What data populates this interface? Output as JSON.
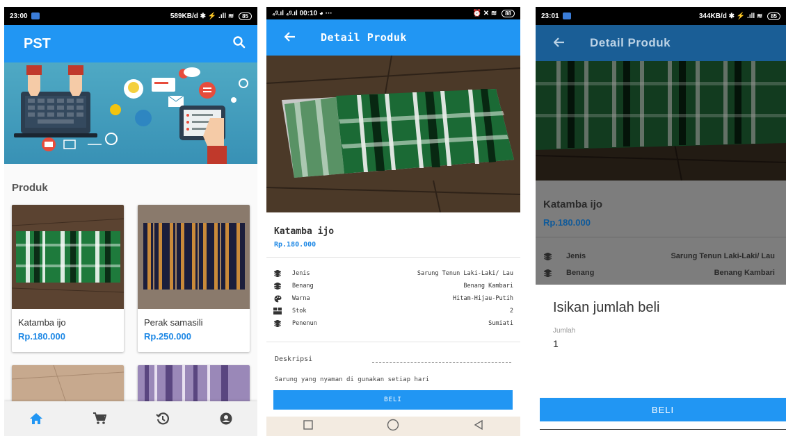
{
  "screen_home": {
    "status": {
      "time": "23:00",
      "right": "589KB/d ✱ ⚡ .ıll ≋",
      "battery": "85"
    },
    "app_title": "PST",
    "section_title": "Produk",
    "products": [
      {
        "name": "Katamba ijo",
        "price": "Rp.180.000"
      },
      {
        "name": "Perak samasili",
        "price": "Rp.250.000"
      }
    ]
  },
  "screen_detail": {
    "status": {
      "left": "₄ᵍ.ıl ₄ᵍ.ıl 00:10 ◕ ···",
      "right": "⏰ ✕ ≋",
      "battery": "88"
    },
    "title": "Detail Produk",
    "product_name": "Katamba ijo",
    "price": "Rp.180.000",
    "specs": [
      {
        "key": "Jenis",
        "value": "Sarung Tenun Laki-Laki/ Lau",
        "icon": "layers-icon"
      },
      {
        "key": "Benang",
        "value": "Benang Kambari",
        "icon": "layers-icon"
      },
      {
        "key": "Warna",
        "value": "Hitam-Hijau-Putih",
        "icon": "palette-icon"
      },
      {
        "key": "Stok",
        "value": "2",
        "icon": "box-icon"
      },
      {
        "key": "Penenun",
        "value": "Sumiati",
        "icon": "layers-icon"
      }
    ],
    "description_label": "Deskripsi",
    "description": "Sarung yang nyaman di gunakan setiap hari",
    "buy_label": "BELI"
  },
  "screen_buy": {
    "status": {
      "time": "23:01",
      "right": "344KB/d ✱ ⚡ .ıll ≋",
      "battery": "85"
    },
    "title": "Detail Produk",
    "product_name": "Katamba ijo",
    "price": "Rp.180.000",
    "specs": [
      {
        "key": "Jenis",
        "value": "Sarung Tenun Laki-Laki/ Lau"
      },
      {
        "key": "Benang",
        "value": "Benang Kambari"
      }
    ],
    "dialog_title": "Isikan jumlah beli",
    "qty_label": "Jumlah",
    "qty_value": "1",
    "buy_label": "BELI"
  },
  "colors": {
    "primary": "#2196f3",
    "price": "#1e88e5"
  }
}
